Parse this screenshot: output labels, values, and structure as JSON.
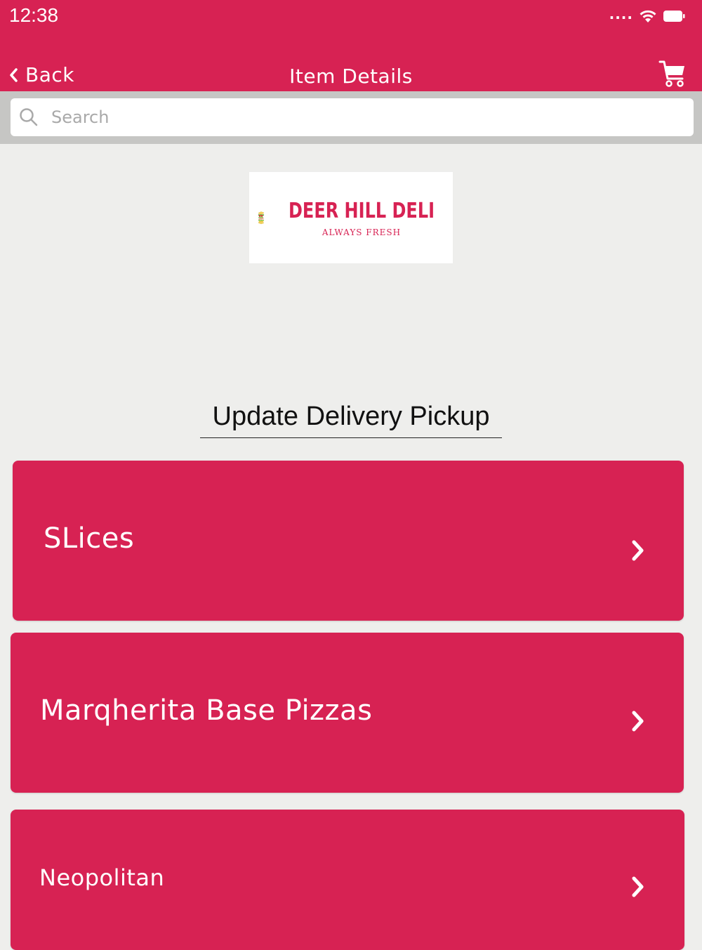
{
  "status_bar": {
    "time": "12:38",
    "signal_icon": "signal-dots-icon",
    "wifi_icon": "wifi-icon",
    "battery_icon": "battery-icon"
  },
  "nav": {
    "back_label": "Back",
    "title": "Item Details",
    "cart_icon": "cart-icon"
  },
  "search": {
    "placeholder": "Search",
    "value": ""
  },
  "logo": {
    "name": "DEER HILL DELI",
    "tagline": "ALWAYS FRESH"
  },
  "section_title": "Update Delivery Pickup",
  "categories": [
    {
      "label": "SLices"
    },
    {
      "label": "Marqherita Base Pizzas"
    },
    {
      "label": "Neopolitan"
    }
  ],
  "colors": {
    "brand": "#d72253",
    "background": "#eeeeec",
    "search_bar_bg": "#c6c6c4"
  }
}
